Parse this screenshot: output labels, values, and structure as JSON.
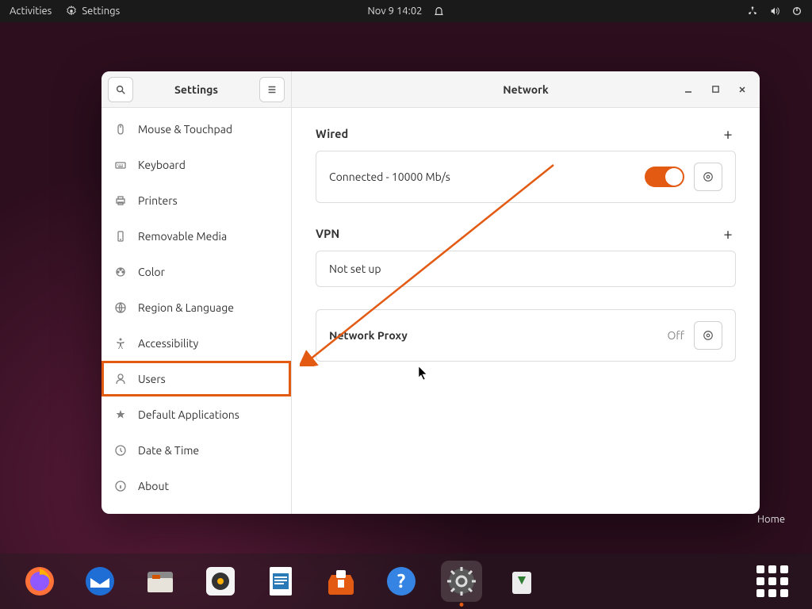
{
  "topbar": {
    "activities": "Activities",
    "app": "Settings",
    "datetime": "Nov 9  14:02"
  },
  "window": {
    "sidebar_title": "Settings",
    "main_title": "Network",
    "items": [
      {
        "icon": "mouse",
        "label": "Mouse & Touchpad"
      },
      {
        "icon": "keyboard",
        "label": "Keyboard"
      },
      {
        "icon": "printer",
        "label": "Printers"
      },
      {
        "icon": "media",
        "label": "Removable Media"
      },
      {
        "icon": "color",
        "label": "Color"
      },
      {
        "icon": "globe",
        "label": "Region & Language"
      },
      {
        "icon": "accessibility",
        "label": "Accessibility"
      },
      {
        "icon": "user",
        "label": "Users"
      },
      {
        "icon": "star",
        "label": "Default Applications"
      },
      {
        "icon": "clock",
        "label": "Date & Time"
      },
      {
        "icon": "info",
        "label": "About"
      }
    ]
  },
  "network": {
    "wired_title": "Wired",
    "wired_status": "Connected - 10000 Mb/s",
    "vpn_title": "VPN",
    "vpn_status": "Not set up",
    "proxy_title": "Network Proxy",
    "proxy_status": "Off"
  },
  "desktop": {
    "home_label": "Home"
  },
  "dock": [
    "firefox",
    "thunderbird",
    "files",
    "rhythmbox",
    "libreoffice",
    "software",
    "help",
    "settings",
    "trash"
  ]
}
